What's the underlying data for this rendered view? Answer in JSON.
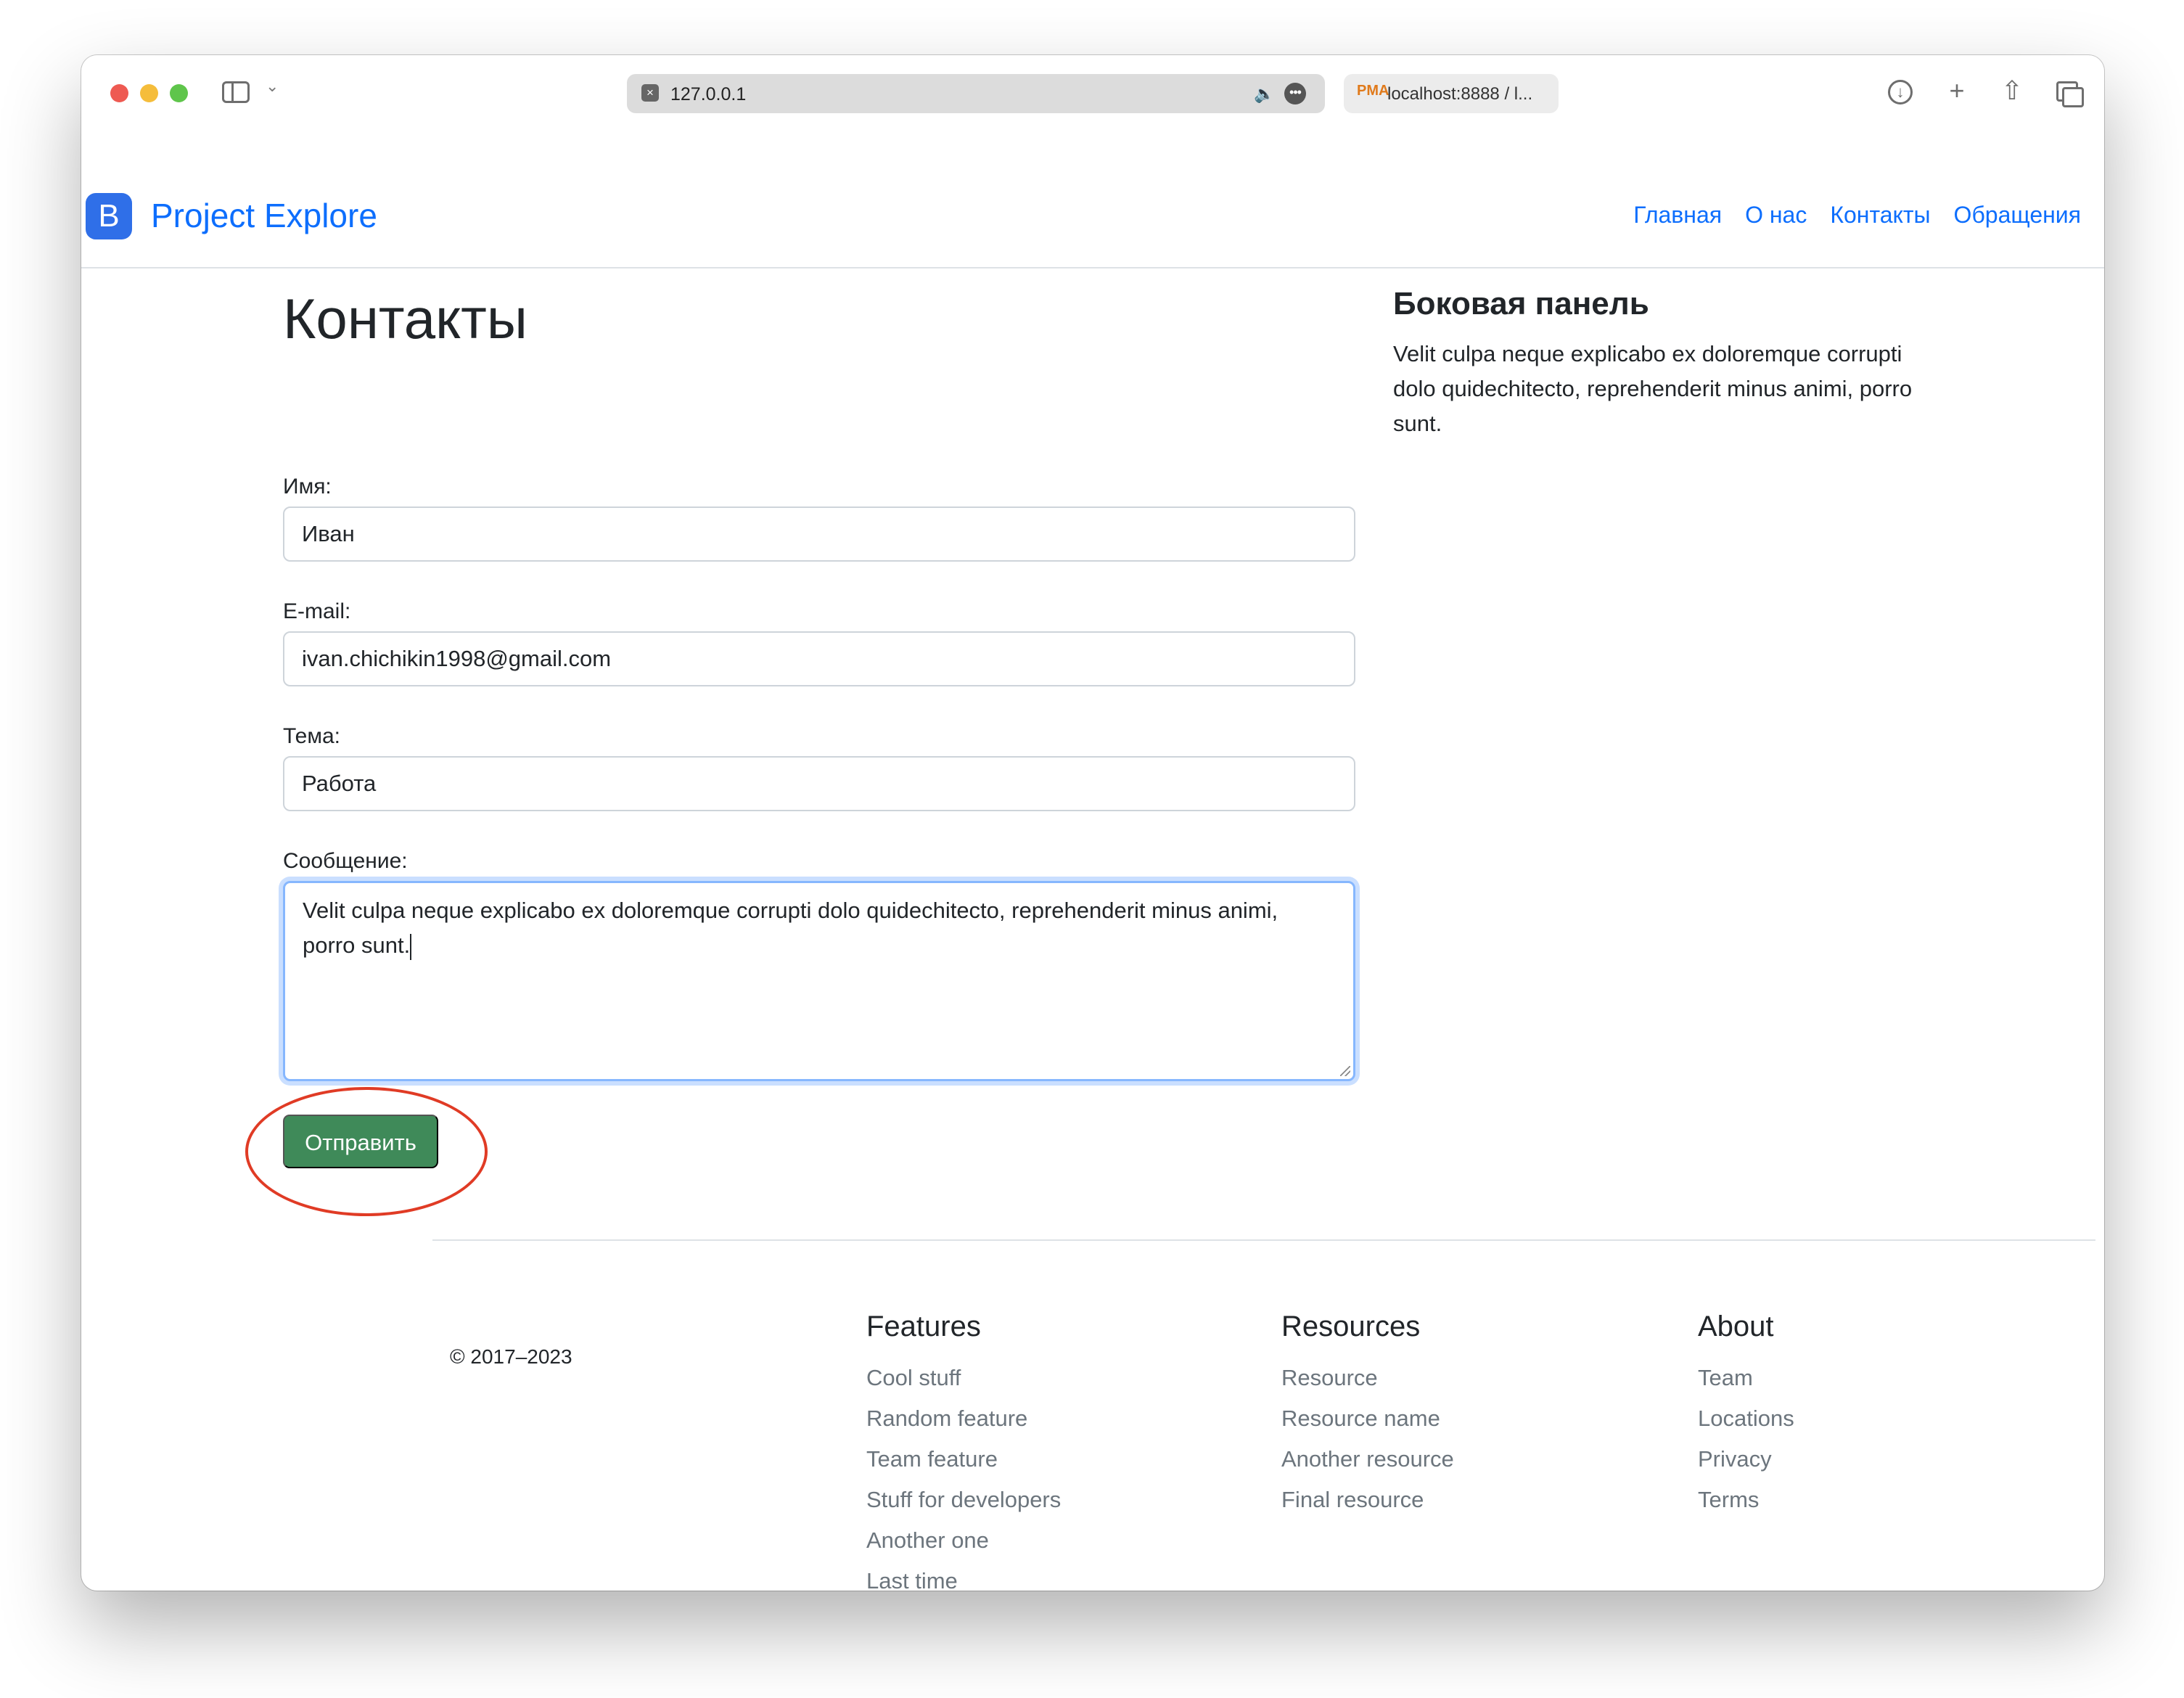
{
  "browser": {
    "url": "127.0.0.1",
    "second_tab_title": "localhost:8888 / l...",
    "pma_logo_text": "PMA"
  },
  "navbar": {
    "brand_letter": "B",
    "brand_name": "Project Explore",
    "links": [
      "Главная",
      "О нас",
      "Контакты",
      "Обращения"
    ]
  },
  "main": {
    "title": "Контакты",
    "form": {
      "name_label": "Имя:",
      "name_value": "Иван",
      "email_label": "E-mail:",
      "email_value": "ivan.chichikin1998@gmail.com",
      "subject_label": "Тема:",
      "subject_value": "Работа",
      "message_label": "Сообщение:",
      "message_value": "Velit culpa neque explicabo ex doloremque corrupti dolo quidechitecto, reprehenderit minus animi, porro sunt.",
      "submit_label": "Отправить"
    }
  },
  "sidebar": {
    "title": "Боковая панель",
    "text": "Velit culpa neque explicabo ex doloremque corrupti dolo quidechitecto, reprehenderit minus animi, porro sunt."
  },
  "footer": {
    "copyright": "© 2017–2023",
    "columns": [
      {
        "title": "Features",
        "items": [
          "Cool stuff",
          "Random feature",
          "Team feature",
          "Stuff for developers",
          "Another one",
          "Last time"
        ]
      },
      {
        "title": "Resources",
        "items": [
          "Resource",
          "Resource name",
          "Another resource",
          "Final resource"
        ]
      },
      {
        "title": "About",
        "items": [
          "Team",
          "Locations",
          "Privacy",
          "Terms"
        ]
      }
    ]
  },
  "colors": {
    "link": "#0d6efd",
    "submit_bg": "#3f8a59",
    "annotation_ellipse": "#e03b25",
    "focus_ring": "#86b7fe"
  }
}
